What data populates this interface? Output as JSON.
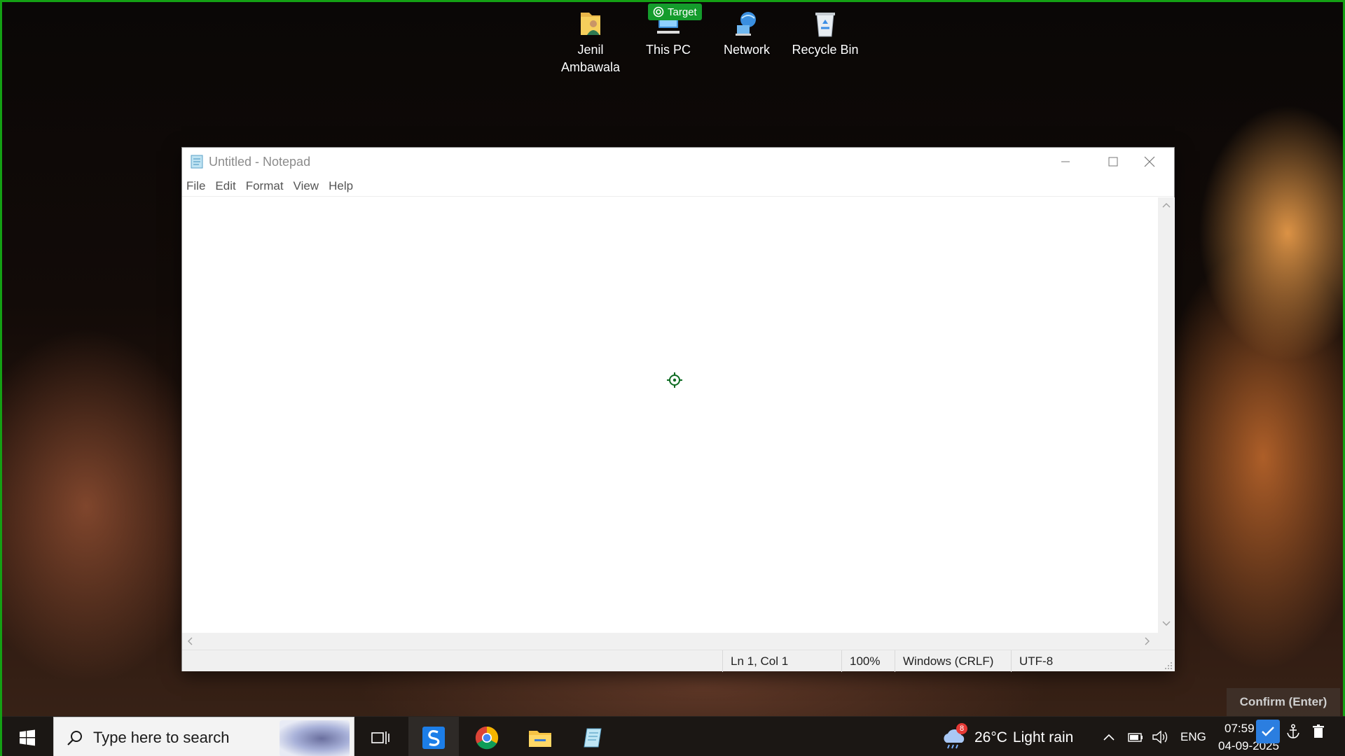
{
  "desktop": {
    "icons": [
      {
        "label": "Jenil Ambawala",
        "icon": "user-folder-icon"
      },
      {
        "label": "This PC",
        "icon": "computer-icon"
      },
      {
        "label": "Network",
        "icon": "network-icon"
      },
      {
        "label": "Recycle Bin",
        "icon": "recycle-bin-icon"
      }
    ],
    "target_badge": "Target"
  },
  "notepad": {
    "title": "Untitled - Notepad",
    "menu": [
      "File",
      "Edit",
      "Format",
      "View",
      "Help"
    ],
    "content": "",
    "status": {
      "position": "Ln 1, Col 1",
      "zoom": "100%",
      "line_endings": "Windows (CRLF)",
      "encoding": "UTF-8"
    }
  },
  "taskbar": {
    "search_placeholder": "Type here to search",
    "weather": {
      "temp": "26°C",
      "condition": "Light rain",
      "badge": "8"
    },
    "language": "ENG",
    "time": "07:59",
    "date": "04-09-2025"
  },
  "overlay": {
    "confirm_label": "Confirm (Enter)"
  },
  "colors": {
    "accent_green": "#149c2c",
    "frame_green": "#14a014"
  }
}
